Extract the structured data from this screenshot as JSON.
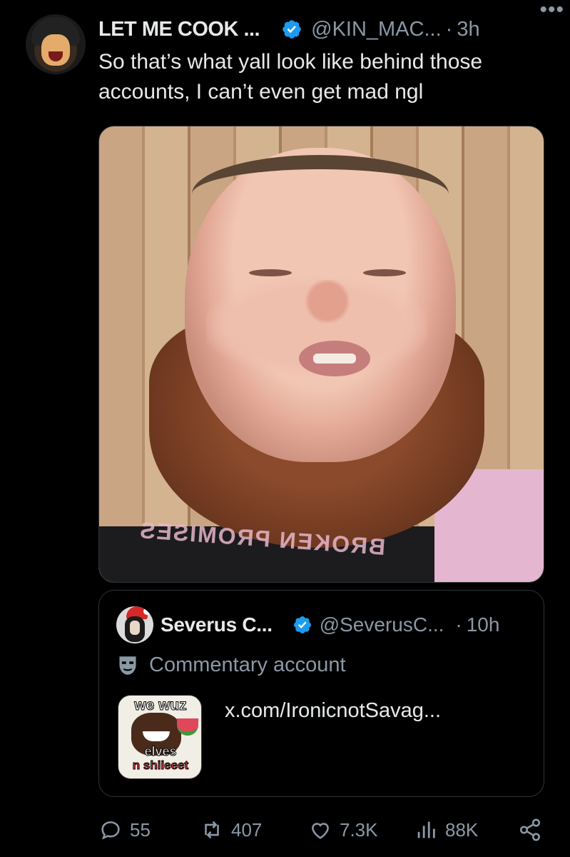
{
  "tweet": {
    "author_name": "LET ME COOK ...",
    "author_handle": "@KIN_MAC...",
    "separator": "·",
    "time": "3h",
    "more_label": "•••",
    "text": "So that’s what yall look like behind those accounts, I can’t even get mad ngl"
  },
  "photo": {
    "shirt_print": "BROKEN PROMISES"
  },
  "quoted": {
    "author_name": "Severus C...",
    "author_handle": "@SeverusC...",
    "separator": "·",
    "time": "10h",
    "account_label": "Commentary account",
    "thumbnail_text": [
      "we wuz",
      "elves",
      "n shiieeet"
    ],
    "link": "x.com/IronicnotSavag..."
  },
  "actions": {
    "replies": "55",
    "reposts": "407",
    "likes": "7.3K",
    "views": "88K"
  },
  "colors": {
    "background": "#000000",
    "text_primary": "#e7e9ea",
    "text_secondary": "#8b98a5",
    "verified_blue": "#1d9bf0",
    "border": "#2f3336"
  },
  "icons": [
    "verified-badge-icon",
    "more-icon",
    "mask-icon",
    "reply-icon",
    "retweet-icon",
    "like-icon",
    "views-icon",
    "share-icon"
  ]
}
